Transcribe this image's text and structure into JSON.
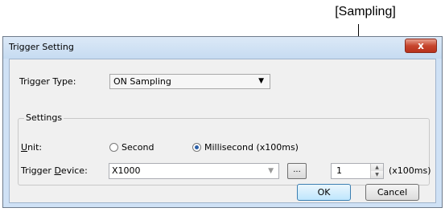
{
  "annotation": {
    "label": "[Sampling]"
  },
  "window": {
    "title": "Trigger Setting",
    "close_glyph": "x"
  },
  "trigger_type": {
    "label": "Trigger Type:",
    "value": "ON Sampling",
    "arrow": "▼"
  },
  "settings": {
    "group_label": "Settings",
    "unit": {
      "label_prefix": "U",
      "label_rest": "nit:",
      "options": [
        {
          "label": "Second",
          "checked": false
        },
        {
          "label": "Millisecond (x100ms)",
          "checked": true
        }
      ]
    },
    "trigger_device": {
      "label_a": "Trigger ",
      "label_u": "D",
      "label_b": "evice:",
      "value": "X1000",
      "arrow": "▼",
      "browse_label": "..."
    },
    "sampling": {
      "value": "1",
      "up_glyph": "▲",
      "down_glyph": "▼",
      "unit_label": "(x100ms)"
    }
  },
  "buttons": {
    "ok": "OK",
    "cancel": "Cancel"
  }
}
